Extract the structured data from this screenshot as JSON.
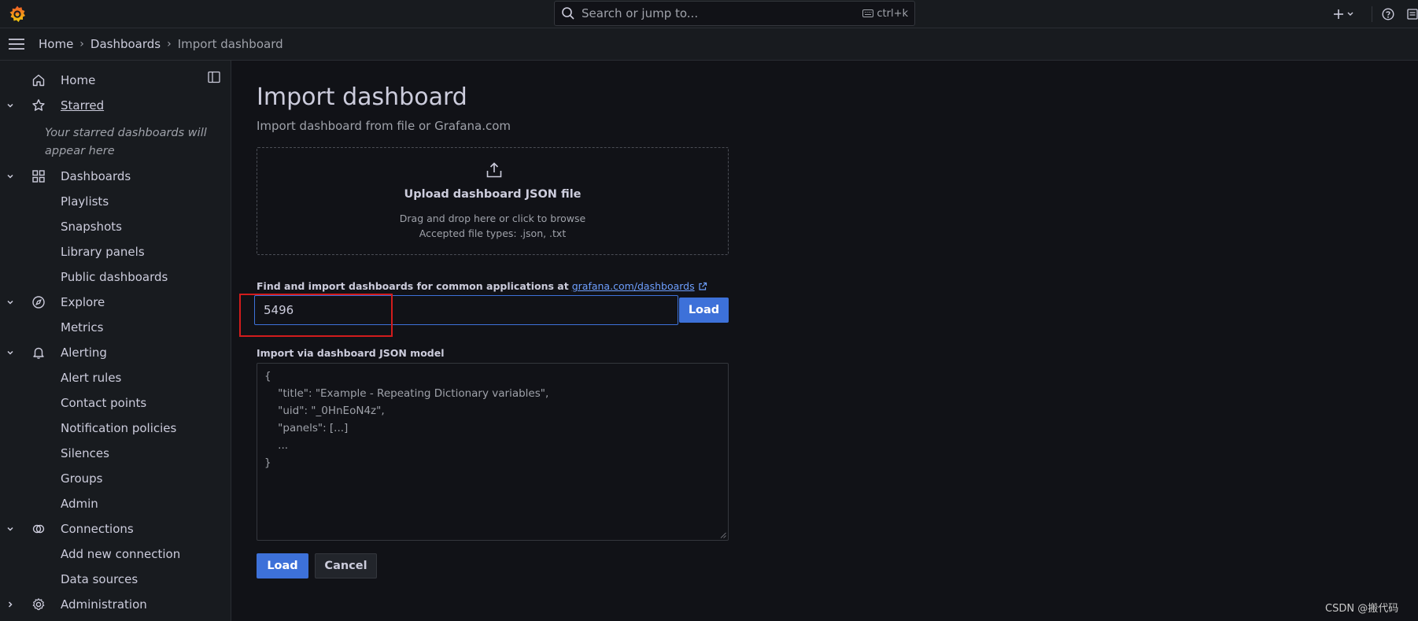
{
  "app": {
    "logo_icon": "grafana-logo-icon"
  },
  "topbar": {
    "search_placeholder": "Search or jump to...",
    "shortcut": "ctrl+k",
    "add_icon": "plus-icon",
    "help_icon": "help-circle-icon",
    "news_icon": "news-icon"
  },
  "breadcrumb": [
    "Home",
    "Dashboards",
    "Import dashboard"
  ],
  "sidebar": {
    "items": [
      {
        "label": "Home",
        "icon": "home-icon",
        "expandable": false
      },
      {
        "label": "Starred",
        "icon": "star-icon",
        "expandable": true,
        "expanded": true
      },
      {
        "label": "Dashboards",
        "icon": "apps-icon",
        "expandable": true,
        "expanded": true
      },
      {
        "label": "Playlists"
      },
      {
        "label": "Snapshots"
      },
      {
        "label": "Library panels"
      },
      {
        "label": "Public dashboards"
      },
      {
        "label": "Explore",
        "icon": "compass-icon",
        "expandable": true,
        "expanded": true
      },
      {
        "label": "Metrics"
      },
      {
        "label": "Alerting",
        "icon": "bell-icon",
        "expandable": true,
        "expanded": true
      },
      {
        "label": "Alert rules"
      },
      {
        "label": "Contact points"
      },
      {
        "label": "Notification policies"
      },
      {
        "label": "Silences"
      },
      {
        "label": "Groups"
      },
      {
        "label": "Admin"
      },
      {
        "label": "Connections",
        "icon": "connections-icon",
        "expandable": true,
        "expanded": true
      },
      {
        "label": "Add new connection"
      },
      {
        "label": "Data sources"
      },
      {
        "label": "Administration",
        "icon": "cog-icon",
        "expandable": true,
        "expanded": false
      }
    ],
    "starred_empty": "Your starred dashboards will appear here"
  },
  "main": {
    "title": "Import dashboard",
    "subtitle": "Import dashboard from file or Grafana.com",
    "upload": {
      "title": "Upload dashboard JSON file",
      "line1": "Drag and drop here or click to browse",
      "line2": "Accepted file types: .json, .txt"
    },
    "find_label": "Find and import dashboards for common applications at",
    "find_link": "grafana.com/dashboards",
    "id_value": "5496",
    "load_label": "Load",
    "json_label": "Import via dashboard JSON model",
    "json_lines": [
      "{",
      "    \"title\": \"Example - Repeating Dictionary variables\",",
      "    \"uid\": \"_0HnEoN4z\",",
      "    \"panels\": [...]",
      "    ...",
      "}"
    ],
    "cancel_label": "Cancel"
  },
  "watermark": "CSDN @搬代码",
  "colors": {
    "accent": "#3d71d9",
    "background": "#111217",
    "panel": "#181b1f",
    "highlight": "#d21c1c"
  }
}
